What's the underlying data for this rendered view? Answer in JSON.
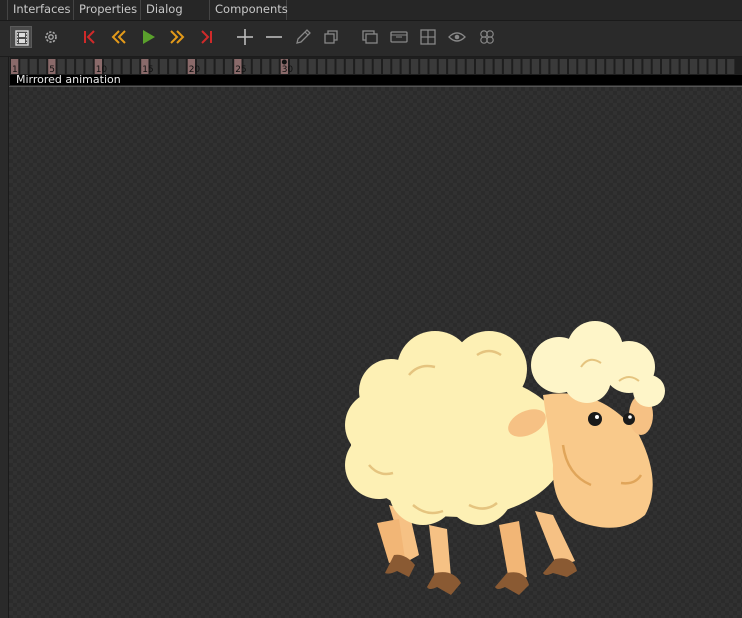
{
  "tabs": [
    {
      "label": "Interfaces"
    },
    {
      "label": "Properties"
    },
    {
      "label": "Dialog area"
    },
    {
      "label": "Components"
    }
  ],
  "toolbar": {
    "buttons": [
      {
        "name": "film-icon",
        "active": true
      },
      {
        "name": "gear-icon"
      },
      {
        "name": "first-frame-icon",
        "color": "#d02a2a"
      },
      {
        "name": "rewind-icon",
        "color": "#e39a1a"
      },
      {
        "name": "play-icon",
        "color": "#5aa02c"
      },
      {
        "name": "fast-forward-icon",
        "color": "#e39a1a"
      },
      {
        "name": "last-frame-icon",
        "color": "#d02a2a"
      },
      {
        "name": "plus-icon"
      },
      {
        "name": "minus-icon"
      },
      {
        "name": "pencil-icon"
      },
      {
        "name": "duplicate-icon"
      },
      {
        "name": "layers-icon"
      },
      {
        "name": "frame-sequence-icon"
      },
      {
        "name": "grid-icon"
      },
      {
        "name": "eye-icon"
      },
      {
        "name": "onion-skin-icon"
      }
    ]
  },
  "timeline": {
    "frame_numbers": [
      "1",
      "5",
      "10",
      "15",
      "20",
      "25",
      "30"
    ],
    "current_frame": 30
  },
  "animation": {
    "label": "Mirrored animation"
  },
  "colors": {
    "background": "#2b2b2b",
    "checker": "#313131",
    "sheep_wool": "#fdf0b4",
    "sheep_skin": "#f9c98a",
    "sheep_hoof": "#8a5a33"
  }
}
